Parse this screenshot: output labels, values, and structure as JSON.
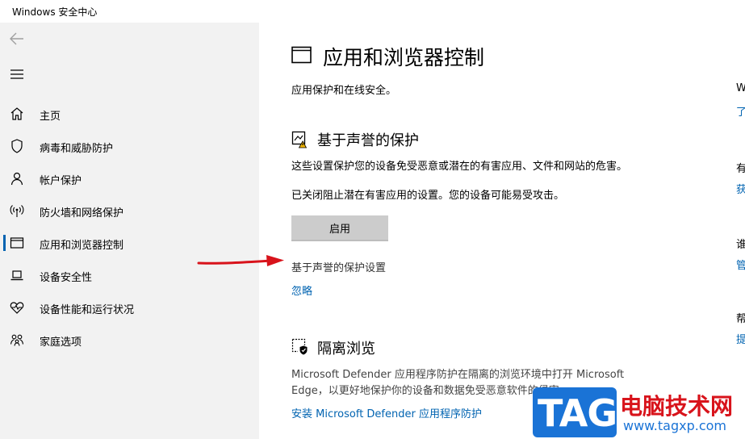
{
  "window": {
    "title": "Windows 安全中心"
  },
  "sidebar": {
    "items": [
      {
        "label": "主页",
        "icon": "home-icon"
      },
      {
        "label": "病毒和威胁防护",
        "icon": "shield-icon"
      },
      {
        "label": "帐户保护",
        "icon": "person-icon"
      },
      {
        "label": "防火墙和网络保护",
        "icon": "wifi-signal-icon"
      },
      {
        "label": "应用和浏览器控制",
        "icon": "app-window-icon",
        "active": true
      },
      {
        "label": "设备安全性",
        "icon": "laptop-icon"
      },
      {
        "label": "设备性能和运行状况",
        "icon": "heart-pulse-icon"
      },
      {
        "label": "家庭选项",
        "icon": "family-icon"
      }
    ]
  },
  "main": {
    "title": "应用和浏览器控制",
    "subtitle": "应用保护和在线安全。",
    "reputation": {
      "title": "基于声誉的保护",
      "desc": "这些设置保护您的设备免受恶意或潜在的有害应用、文件和网站的危害。",
      "warning": "已关闭阻止潜在有害应用的设置。您的设备可能易受攻击。",
      "enable_label": "启用",
      "settings_link": "基于声誉的保护设置",
      "ignore_link": "忽略"
    },
    "isolated": {
      "title": "隔离浏览",
      "desc_line1": "Microsoft Defender 应用程序防护在隔离的浏览环境中打开 Microsoft",
      "desc_line2": "Edge，以更好地保护你的设备和数据免受恶意软件的侵害。",
      "install_link": "安装 Microsoft Defender 应用程序防护"
    }
  },
  "right_column": {
    "fragments": [
      "W",
      "了",
      "有",
      "获",
      "谁",
      "管",
      "帮",
      "提"
    ]
  },
  "watermark": {
    "tag": "TAG",
    "cn": "电脑技术网",
    "url": "www.tagxp.com"
  },
  "colors": {
    "accent": "#0063b1",
    "sidebar_bg": "#f2f2f2",
    "arrow": "#d8131b"
  }
}
